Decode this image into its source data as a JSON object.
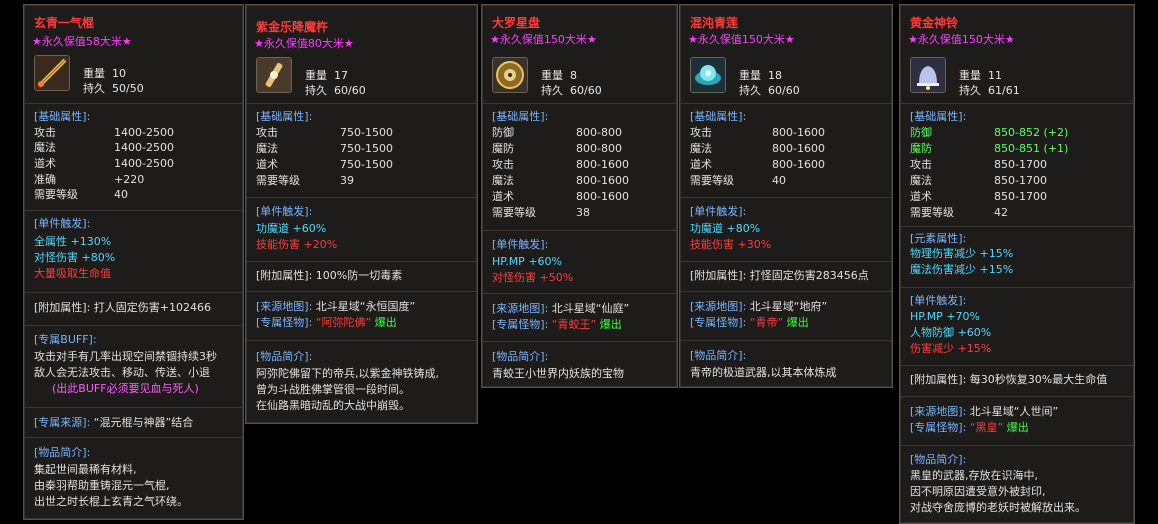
{
  "cards": [
    {
      "title": "玄青一气棍",
      "star": "★永久保值58大米★",
      "icon": "staff-icon",
      "weight_label": "重量",
      "weight": "10",
      "dur_label": "持久",
      "dur": "50/50",
      "base_header": "[基础属性]:",
      "base": [
        {
          "k": "攻击",
          "v": "1400-2500"
        },
        {
          "k": "魔法",
          "v": "1400-2500"
        },
        {
          "k": "道术",
          "v": "1400-2500"
        },
        {
          "k": "准确",
          "v": "+220"
        },
        {
          "k": "需要等级",
          "v": "40"
        }
      ],
      "trigger_header": "[单件触发]:",
      "triggers": [
        {
          "k": "全属性",
          "v": "+130%"
        },
        {
          "k": "对怪伤害",
          "v": "+80%"
        },
        {
          "k": "大量吸取生命值",
          "v": ""
        }
      ],
      "extra": "[附加属性]: 打人固定伤害+102466",
      "buff_header": "[专属BUFF]:",
      "buff": [
        "攻击对手有几率出现空间禁锢持续3秒",
        "敌人会无法攻击、移动、传送、小退",
        "(出此BUFF必须要见血与死人)"
      ],
      "source_header": "[专属来源]:",
      "source": "“混元棍与神器”结合",
      "desc_header": "[物品简介]:",
      "desc": [
        "集起世间最稀有材料,",
        "由秦羽帮助重铸混元一气棍,",
        "出世之时长棍上玄青之气环绕。"
      ]
    },
    {
      "title": "紫金乐降魔杵",
      "star": "★永久保值80大米★",
      "icon": "pestle-icon",
      "weight_label": "重量",
      "weight": "17",
      "dur_label": "持久",
      "dur": "60/60",
      "base_header": "[基础属性]:",
      "base": [
        {
          "k": "攻击",
          "v": "750-1500"
        },
        {
          "k": "魔法",
          "v": "750-1500"
        },
        {
          "k": "道术",
          "v": "750-1500"
        },
        {
          "k": "需要等级",
          "v": "39"
        }
      ],
      "trigger_header": "[单件触发]:",
      "triggers": [
        {
          "k": "功魔道",
          "v": "+60%"
        },
        {
          "k": "技能伤害",
          "v": "+20%"
        }
      ],
      "extra": "[附加属性]: 100%防一切毒素",
      "map_header": "[来源地图]:",
      "map": "北斗星域“永恒国度”",
      "mon_header": "[专属怪物]:",
      "mon": "“阿弥陀佛”",
      "mon_tail": "爆出",
      "desc_header": "[物品简介]:",
      "desc": [
        "阿弥陀佛留下的帝兵,以紫金神铁铸成,",
        "曾为斗战胜佛掌管很一段时间。",
        "在仙路黑暗动乱的大战中崩毁。"
      ]
    },
    {
      "title": "大罗星盘",
      "star": "★永久保值150大米★",
      "icon": "star-disk-icon",
      "weight_label": "重量",
      "weight": "8",
      "dur_label": "持久",
      "dur": "60/60",
      "base_header": "[基础属性]:",
      "base": [
        {
          "k": "防御",
          "v": "800-800"
        },
        {
          "k": "魔防",
          "v": "800-800"
        },
        {
          "k": "攻击",
          "v": "800-1600"
        },
        {
          "k": "魔法",
          "v": "800-1600"
        },
        {
          "k": "道术",
          "v": "800-1600"
        },
        {
          "k": "需要等级",
          "v": "38"
        }
      ],
      "trigger_header": "[单件触发]:",
      "triggers": [
        {
          "k": "HP.MP",
          "v": "+60%"
        },
        {
          "k": "对怪伤害",
          "v": "+50%"
        }
      ],
      "map_header": "[来源地图]:",
      "map": "北斗星域“仙庭”",
      "mon_header": "[专属怪物]:",
      "mon": "“青蛟王”",
      "mon_tail": "爆出",
      "desc_header": "[物品简介]:",
      "desc": [
        "青蛟王小世界内妖族的宝物"
      ]
    },
    {
      "title": "混沌青莲",
      "star": "★永久保值150大米★",
      "icon": "lotus-icon",
      "weight_label": "重量",
      "weight": "18",
      "dur_label": "持久",
      "dur": "60/60",
      "base_header": "[基础属性]:",
      "base": [
        {
          "k": "攻击",
          "v": "800-1600"
        },
        {
          "k": "魔法",
          "v": "800-1600"
        },
        {
          "k": "道术",
          "v": "800-1600"
        },
        {
          "k": "需要等级",
          "v": "40"
        }
      ],
      "trigger_header": "[单件触发]:",
      "triggers": [
        {
          "k": "功魔道",
          "v": "+80%"
        },
        {
          "k": "技能伤害",
          "v": "+30%"
        }
      ],
      "extra": "[附加属性]: 打怪固定伤害283456点",
      "map_header": "[来源地图]:",
      "map": "北斗星域“地府”",
      "mon_header": "[专属怪物]:",
      "mon": "“青帝”",
      "mon_tail": "爆出",
      "desc_header": "[物品简介]:",
      "desc": [
        "青帝的极道武器,以其本体炼成"
      ]
    },
    {
      "title": "黄金神铃",
      "star": "★永久保值150大米★",
      "icon": "bell-icon",
      "weight_label": "重量",
      "weight": "11",
      "dur_label": "持久",
      "dur": "61/61",
      "base_header": "[基础属性]:",
      "base": [
        {
          "k": "防御",
          "v": "850-852 (+2)",
          "green": true
        },
        {
          "k": "魔防",
          "v": "850-851 (+1)",
          "green": true
        },
        {
          "k": "攻击",
          "v": "850-1700"
        },
        {
          "k": "魔法",
          "v": "850-1700"
        },
        {
          "k": "道术",
          "v": "850-1700"
        },
        {
          "k": "需要等级",
          "v": "42"
        }
      ],
      "elem_header": "[元素属性]:",
      "elems": [
        {
          "k": "物理伤害减少",
          "v": "+15%"
        },
        {
          "k": "魔法伤害减少",
          "v": "+15%"
        }
      ],
      "trigger_header": "[单件触发]:",
      "triggers": [
        {
          "k": "HP.MP",
          "v": "+70%"
        },
        {
          "k": "人物防御",
          "v": "+60%"
        },
        {
          "k": "伤害减少",
          "v": "+15%"
        }
      ],
      "extra": "[附加属性]: 每30秒恢复30%最大生命值",
      "map_header": "[来源地图]:",
      "map": "北斗星域“人世间”",
      "mon_header": "[专属怪物]:",
      "mon": "“黑皇”",
      "mon_tail": "爆出",
      "desc_header": "[物品简介]:",
      "desc": [
        "黑皇的武器,存放在识海中,",
        "因不明原因遭受意外被封印,",
        "对战夺舍庞博的老妖时被解放出来。"
      ]
    }
  ]
}
